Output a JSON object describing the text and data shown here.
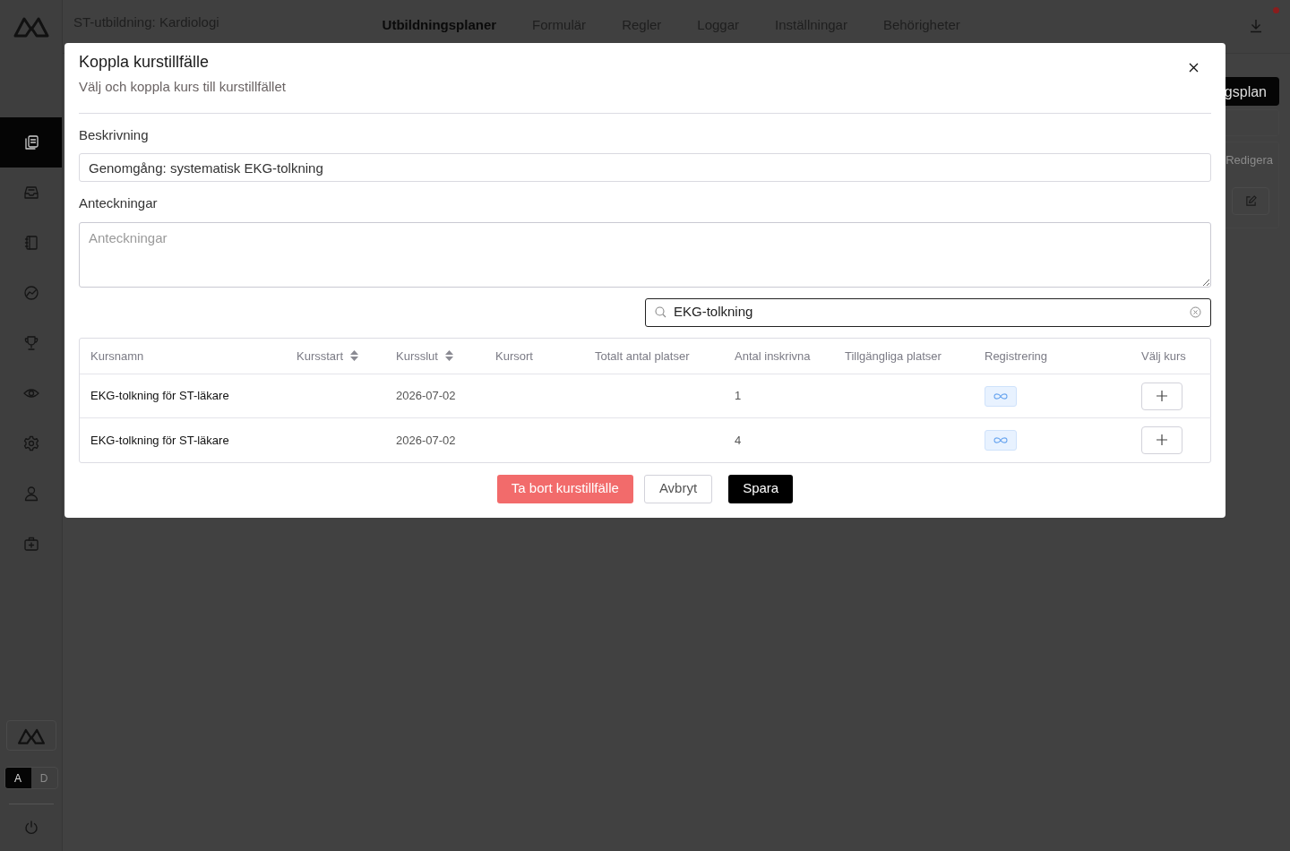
{
  "app": {
    "title": "ST-utbildning: Kardiologi"
  },
  "nav": [
    {
      "label": "Utbildningsplaner",
      "selected": true
    },
    {
      "label": "Formulär",
      "selected": false
    },
    {
      "label": "Regler",
      "selected": false
    },
    {
      "label": "Loggar",
      "selected": false
    },
    {
      "label": "Inställningar",
      "selected": false
    },
    {
      "label": "Behörigheter",
      "selected": false
    }
  ],
  "sidebar": {
    "items": [
      {
        "selected": true
      },
      {
        "selected": false
      },
      {
        "selected": false
      },
      {
        "selected": false
      },
      {
        "selected": false
      },
      {
        "selected": false
      },
      {
        "selected": false
      },
      {
        "selected": false
      },
      {
        "selected": false
      }
    ]
  },
  "theme_toggle": [
    {
      "label": "A",
      "selected": true
    },
    {
      "label": "D",
      "selected": false
    }
  ],
  "background": {
    "primary_button": "gsplan",
    "edit_label": "Redigera"
  },
  "modal": {
    "title": "Koppla kurstillfälle",
    "subtitle": "Välj och koppla kurs till kurstillfället",
    "fields": [
      {
        "kind": "input",
        "label": "Beskrivning",
        "value": "Genomgång: systematisk EKG-tolkning"
      },
      {
        "kind": "textarea",
        "label": "Anteckningar",
        "placeholder": "Anteckningar"
      }
    ],
    "search": {
      "value": "EKG-tolkning"
    },
    "table": {
      "columns": [
        {
          "label": "Kursnamn",
          "sortable": false
        },
        {
          "label": "Kursstart",
          "sortable": true
        },
        {
          "label": "Kursslut",
          "sortable": true
        },
        {
          "label": "Kursort",
          "sortable": false
        },
        {
          "label": "Totalt antal platser",
          "sortable": false
        },
        {
          "label": "Antal inskrivna",
          "sortable": false
        },
        {
          "label": "Tillgängliga platser",
          "sortable": false
        },
        {
          "label": "Registrering",
          "sortable": false
        },
        {
          "label": "Välj kurs",
          "sortable": false
        }
      ],
      "rows": [
        {
          "cells": [
            "EKG-tolkning för ST-läkare",
            null,
            "2026-07-02",
            null,
            null,
            "1",
            null
          ]
        },
        {
          "cells": [
            "EKG-tolkning för ST-läkare",
            null,
            "2026-07-02",
            null,
            null,
            "4",
            null
          ]
        }
      ]
    },
    "buttons": [
      {
        "label": "Ta bort kurstillfälle",
        "kind": "danger"
      },
      {
        "label": "Avbryt",
        "kind": "secondary"
      },
      {
        "label": "Spara",
        "kind": "primary"
      }
    ]
  }
}
